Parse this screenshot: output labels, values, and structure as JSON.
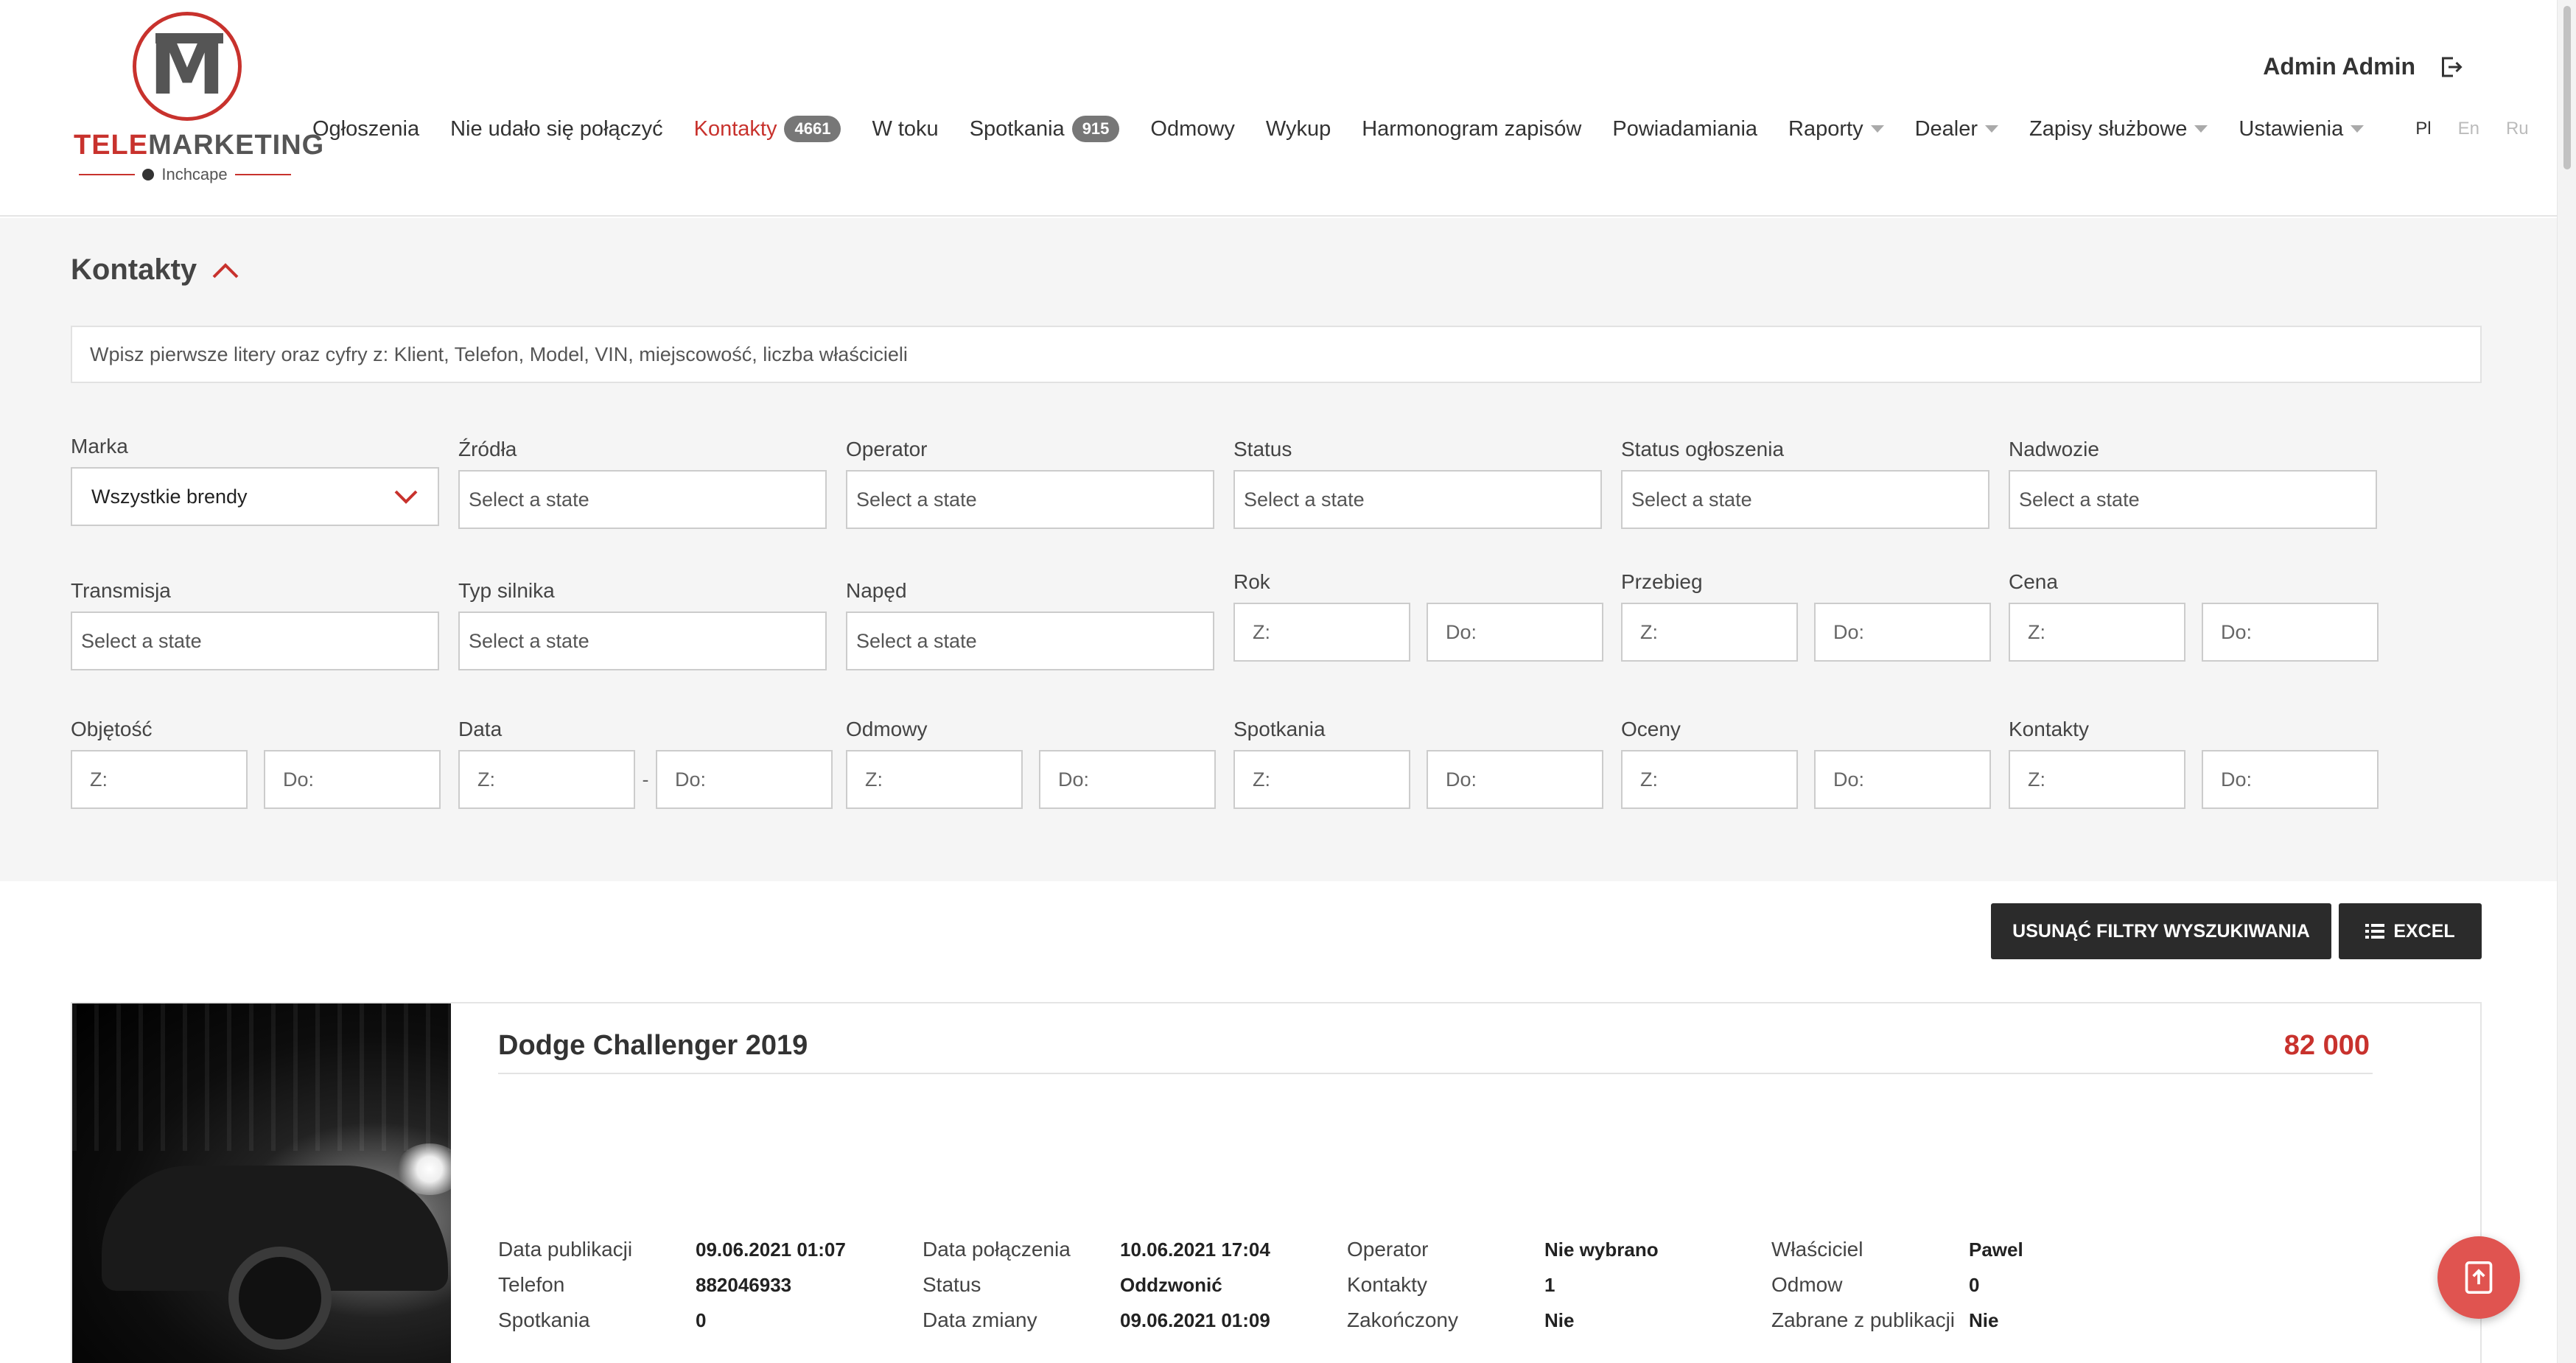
{
  "brand": {
    "name_red": "TELE",
    "name_rest": "MARKETING",
    "sub": "Inchcape",
    "mark": "M"
  },
  "nav": {
    "items": [
      {
        "label": "Ogłoszenia"
      },
      {
        "label": "Nie udało się połączyć"
      },
      {
        "label": "Kontakty",
        "badge": "4661",
        "active": true
      },
      {
        "label": "W toku"
      },
      {
        "label": "Spotkania",
        "badge": "915"
      },
      {
        "label": "Odmowy"
      },
      {
        "label": "Wykup"
      },
      {
        "label": "Harmonogram zapisów"
      },
      {
        "label": "Powiadamiania"
      },
      {
        "label": "Raporty",
        "dropdown": true
      },
      {
        "label": "Dealer",
        "dropdown": true
      },
      {
        "label": "Zapisy służbowe",
        "dropdown": true
      },
      {
        "label": "Ustawienia",
        "dropdown": true
      }
    ],
    "languages": [
      "Pl",
      "En",
      "Ru"
    ],
    "active_language": "Pl"
  },
  "user": {
    "name": "Admin Admin"
  },
  "page": {
    "title": "Kontakty",
    "search_placeholder": "Wpisz pierwsze litery oraz cyfry z: Klient, Telefon, Model, VIN, miejscowość, liczba właścicieli"
  },
  "filters": {
    "brand": {
      "label": "Marka",
      "value": "Wszystkie brendy"
    },
    "state_placeholder": "Select a state",
    "range_from": "Z:",
    "range_to": "Do:",
    "row1_selects": [
      "Źródła",
      "Operator",
      "Status",
      "Status ogłoszenia",
      "Nadwozie"
    ],
    "row2_selects": [
      "Transmisja",
      "Typ silnika",
      "Napęd"
    ],
    "row2_ranges": [
      "Rok",
      "Przebieg",
      "Cena"
    ],
    "row3_ranges": [
      "Objętość",
      "Data",
      "Odmowy",
      "Spotkania",
      "Oceny",
      "Kontakty"
    ]
  },
  "actions": {
    "clear_label": "USUNĄĆ FILTRY WYSZUKIWANIA",
    "excel_label": "EXCEL"
  },
  "listing": {
    "title": "Dodge Challenger 2019",
    "price": "82 000",
    "columns": [
      [
        {
          "label": "Data publikacji",
          "value": "09.06.2021 01:07"
        },
        {
          "label": "Telefon",
          "value": "882046933"
        },
        {
          "label": "Spotkania",
          "value": "0"
        }
      ],
      [
        {
          "label": "Data połączenia",
          "value": "10.06.2021 17:04"
        },
        {
          "label": "Status",
          "value": "Oddzwonić"
        },
        {
          "label": "Data zmiany",
          "value": "09.06.2021 01:09"
        }
      ],
      [
        {
          "label": "Operator",
          "value": "Nie wybrano"
        },
        {
          "label": "Kontakty",
          "value": "1"
        },
        {
          "label": "Zakończony",
          "value": "Nie"
        }
      ],
      [
        {
          "label": "Właściciel",
          "value": "Pawel"
        },
        {
          "label": "Odmow",
          "value": "0"
        },
        {
          "label": "Zabrane z publikacji",
          "value": "Nie"
        }
      ]
    ]
  },
  "colors": {
    "accent": "#c8322d",
    "badge": "#777777",
    "button": "#2b2b2b",
    "fab": "#e05450"
  },
  "icons": {
    "logout": "logout-icon",
    "collapse": "chevron-up-icon",
    "brand_select": "chevron-down-icon",
    "excel": "list-icon",
    "fab": "export-icon"
  }
}
